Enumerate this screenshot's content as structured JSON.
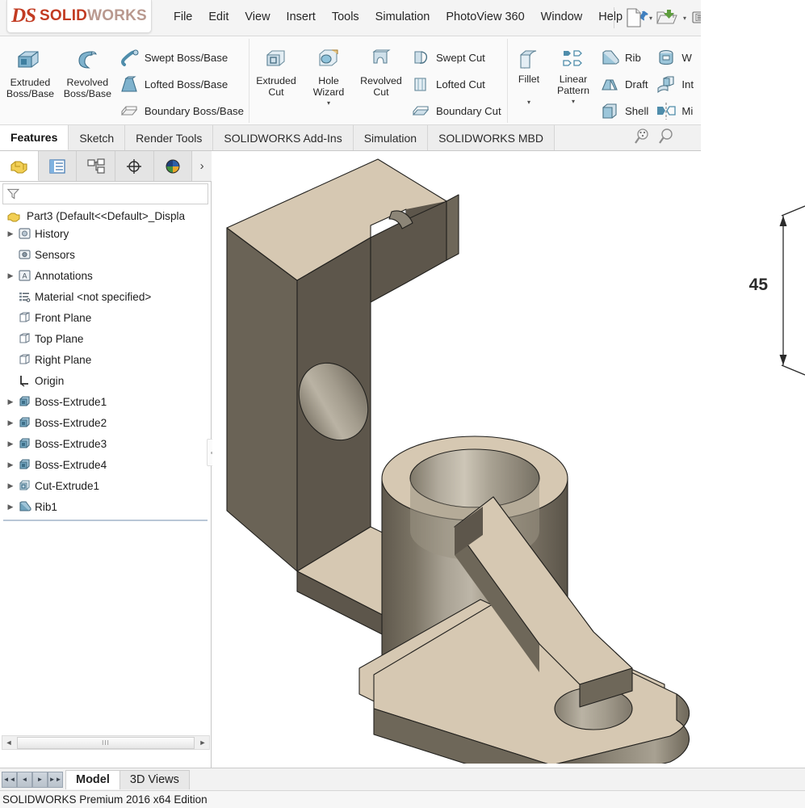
{
  "app": {
    "logo_ds": "DS",
    "logo_solid": "SOLID",
    "logo_works": "WORKS",
    "status_text": "SOLIDWORKS Premium 2016 x64 Edition"
  },
  "menu": {
    "items": [
      {
        "label": "File",
        "icon": "menu-item-file"
      },
      {
        "label": "Edit",
        "icon": "menu-item-edit"
      },
      {
        "label": "View",
        "icon": "menu-item-view"
      },
      {
        "label": "Insert",
        "icon": "menu-item-insert"
      },
      {
        "label": "Tools",
        "icon": "menu-item-tools"
      },
      {
        "label": "Simulation",
        "icon": "menu-item-simulation"
      },
      {
        "label": "PhotoView 360",
        "icon": "menu-item-photoview"
      },
      {
        "label": "Window",
        "icon": "menu-item-window"
      },
      {
        "label": "Help",
        "icon": "menu-item-help"
      }
    ],
    "pin_icon": "pushpin-icon"
  },
  "quick_access": {
    "buttons": [
      {
        "name": "new-document-button",
        "icon": "new-document-icon",
        "has_caret": true
      },
      {
        "name": "open-document-button",
        "icon": "open-folder-icon",
        "has_caret": true
      },
      {
        "name": "save-button",
        "icon": "save-icon",
        "has_caret": false
      },
      {
        "name": "print-button",
        "icon": "print-icon",
        "has_caret": false
      },
      {
        "name": "undo-button",
        "icon": "undo-arrow-icon",
        "has_caret": false
      }
    ]
  },
  "ribbon": {
    "groups": [
      {
        "name": "boss-base-group",
        "big": [
          {
            "label": "Extruded\nBoss/Base",
            "line1": "Extruded",
            "line2": "Boss/Base",
            "icon": "extruded-boss-icon"
          },
          {
            "label": "Revolved\nBoss/Base",
            "line1": "Revolved",
            "line2": "Boss/Base",
            "icon": "revolved-boss-icon"
          }
        ],
        "small": [
          {
            "label": "Swept Boss/Base",
            "icon": "swept-boss-icon"
          },
          {
            "label": "Lofted Boss/Base",
            "icon": "lofted-boss-icon"
          },
          {
            "label": "Boundary Boss/Base",
            "icon": "boundary-boss-icon"
          }
        ]
      },
      {
        "name": "cut-group",
        "big": [
          {
            "line1": "Extruded",
            "line2": "Cut",
            "icon": "extruded-cut-icon",
            "caret": true
          },
          {
            "line1": "Hole",
            "line2": "Wizard",
            "icon": "hole-wizard-icon",
            "caret": true
          },
          {
            "line1": "Revolved",
            "line2": "Cut",
            "icon": "revolved-cut-icon",
            "caret": false
          }
        ],
        "small": [
          {
            "label": "Swept Cut",
            "icon": "swept-cut-icon"
          },
          {
            "label": "Lofted Cut",
            "icon": "lofted-cut-icon"
          },
          {
            "label": "Boundary Cut",
            "icon": "boundary-cut-icon"
          }
        ]
      },
      {
        "name": "features-group",
        "big": [
          {
            "line1": "Fillet",
            "line2": "",
            "icon": "fillet-icon",
            "caret": true
          },
          {
            "line1": "Linear",
            "line2": "Pattern",
            "icon": "linear-pattern-icon",
            "caret": true
          }
        ],
        "small": [
          {
            "label": "Rib",
            "icon": "rib-icon"
          },
          {
            "label": "Draft",
            "icon": "draft-icon"
          },
          {
            "label": "Shell",
            "icon": "shell-icon"
          }
        ],
        "small2": [
          {
            "label": "W",
            "icon": "wrap-icon"
          },
          {
            "label": "Int",
            "icon": "intersect-icon"
          },
          {
            "label": "Mi",
            "icon": "mirror-icon"
          }
        ]
      }
    ]
  },
  "command_tabs": {
    "tabs": [
      {
        "label": "Features",
        "active": true
      },
      {
        "label": "Sketch",
        "active": false
      },
      {
        "label": "Render Tools",
        "active": false
      },
      {
        "label": "SOLIDWORKS Add-Ins",
        "active": false
      },
      {
        "label": "Simulation",
        "active": false
      },
      {
        "label": "SOLIDWORKS MBD",
        "active": false
      }
    ],
    "search_icons": [
      "search-options-icon",
      "search-icon"
    ]
  },
  "left_panel": {
    "tabs": [
      {
        "name": "feature-manager-tab",
        "icon": "feature-tree-icon",
        "active": true
      },
      {
        "name": "property-manager-tab",
        "icon": "property-list-icon",
        "active": false
      },
      {
        "name": "configuration-manager-tab",
        "icon": "configuration-icon",
        "active": false
      },
      {
        "name": "dimxpert-manager-tab",
        "icon": "dimxpert-icon",
        "active": false
      },
      {
        "name": "display-manager-tab",
        "icon": "display-sphere-icon",
        "active": false
      }
    ],
    "more_tabs_glyph": "›",
    "filter": {
      "icon": "filter-funnel-icon",
      "placeholder": "",
      "value": ""
    },
    "root": {
      "icon": "part-icon",
      "label": "Part3  (Default<<Default>_Displa"
    },
    "tree_items": [
      {
        "label": "History",
        "icon": "history-icon",
        "expandable": true
      },
      {
        "label": "Sensors",
        "icon": "sensors-icon",
        "expandable": false
      },
      {
        "label": "Annotations",
        "icon": "annotations-icon",
        "expandable": true
      },
      {
        "label": "Material <not specified>",
        "icon": "material-icon",
        "expandable": false
      },
      {
        "label": "Front Plane",
        "icon": "plane-icon",
        "expandable": false
      },
      {
        "label": "Top Plane",
        "icon": "plane-icon",
        "expandable": false
      },
      {
        "label": "Right Plane",
        "icon": "plane-icon",
        "expandable": false
      },
      {
        "label": "Origin",
        "icon": "origin-icon",
        "expandable": false
      },
      {
        "label": "Boss-Extrude1",
        "icon": "boss-extrude-icon",
        "expandable": true
      },
      {
        "label": "Boss-Extrude2",
        "icon": "boss-extrude-icon",
        "expandable": true
      },
      {
        "label": "Boss-Extrude3",
        "icon": "boss-extrude-icon",
        "expandable": true
      },
      {
        "label": "Boss-Extrude4",
        "icon": "boss-extrude-icon",
        "expandable": true
      },
      {
        "label": "Cut-Extrude1",
        "icon": "cut-extrude-icon",
        "expandable": true
      },
      {
        "label": "Rib1",
        "icon": "rib-feature-icon",
        "expandable": true
      }
    ],
    "hscroll": {
      "left_arrow": "◄",
      "right_arrow": "►",
      "grip": "III"
    }
  },
  "graphics": {
    "model_name": "bearing-bracket-3d-model",
    "dimension": {
      "value": "45",
      "name": "height-dimension"
    },
    "colors": {
      "top_face": "#d8cab4",
      "front_face": "#5d564b",
      "side_face": "#6e675a",
      "cylinder_light": "#b9b2a5",
      "cylinder_dark": "#6a6356",
      "edge": "#2b2b2b"
    }
  },
  "bottom_tabs": {
    "nav_buttons": [
      "◄◄",
      "◄",
      "►",
      "►►"
    ],
    "tabs": [
      {
        "label": "Model",
        "active": true
      },
      {
        "label": "3D Views",
        "active": false
      }
    ]
  }
}
